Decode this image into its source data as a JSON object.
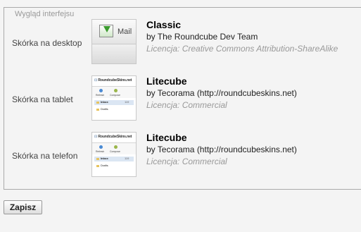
{
  "section": {
    "legend": "Wygląd interfejsu"
  },
  "rows": [
    {
      "label": "Skórka na desktop",
      "skin": {
        "name": "Classic",
        "author": "by The Roundcube Dev Team",
        "license": "Licencja: Creative Commons Attribution-ShareAlike"
      }
    },
    {
      "label": "Skórka na tablet",
      "skin": {
        "name": "Litecube",
        "author": "by Tecorama (http://roundcubeskins.net)",
        "license": "Licencja: Commercial"
      }
    },
    {
      "label": "Skórka na telefon",
      "skin": {
        "name": "Litecube",
        "author": "by Tecorama (http://roundcubeskins.net)",
        "license": "Licencja: Commercial"
      }
    }
  ],
  "thumbs": {
    "classic": {
      "mail_label": "Mail"
    },
    "litecube": {
      "logo_a": "Roundcube",
      "logo_b": "Skins.net",
      "refresh": "Refresh",
      "compose": "Compose",
      "inbox": "Inbox",
      "drafts": "Drafts",
      "count": "119"
    }
  },
  "actions": {
    "save_label": "Zapisz"
  },
  "colors": {
    "accent_star": "#f3b81d",
    "classic_arrow": "#3b9b2e",
    "license_text": "#999999"
  }
}
